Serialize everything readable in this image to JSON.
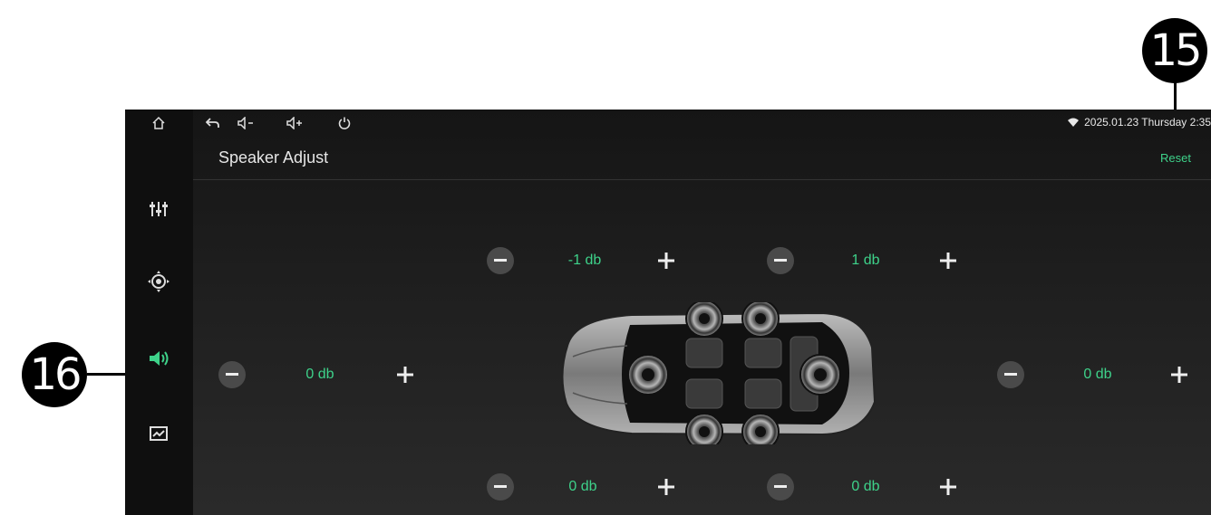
{
  "callouts": {
    "c15": "15",
    "c16": "16"
  },
  "topbar": {
    "home": "home-icon",
    "back": "back-icon",
    "vol_down": "volume-down-icon",
    "vol_up": "volume-up-icon",
    "power": "power-icon",
    "status": "2025.01.23 Thursday 2:35"
  },
  "header": {
    "title": "Speaker Adjust",
    "reset": "Reset"
  },
  "sidebar": {
    "items": [
      {
        "icon": "equalizer-icon"
      },
      {
        "icon": "balance-icon"
      },
      {
        "icon": "speaker-icon",
        "active": true
      },
      {
        "icon": "display-icon"
      }
    ]
  },
  "speakers": {
    "front_left": "-1 db",
    "front_right": "1 db",
    "left": "0 db",
    "right": "0 db",
    "rear_left": "0 db",
    "rear_right": "0 db"
  },
  "colors": {
    "accent": "#3ed28a",
    "background": "#1b1b1b"
  }
}
